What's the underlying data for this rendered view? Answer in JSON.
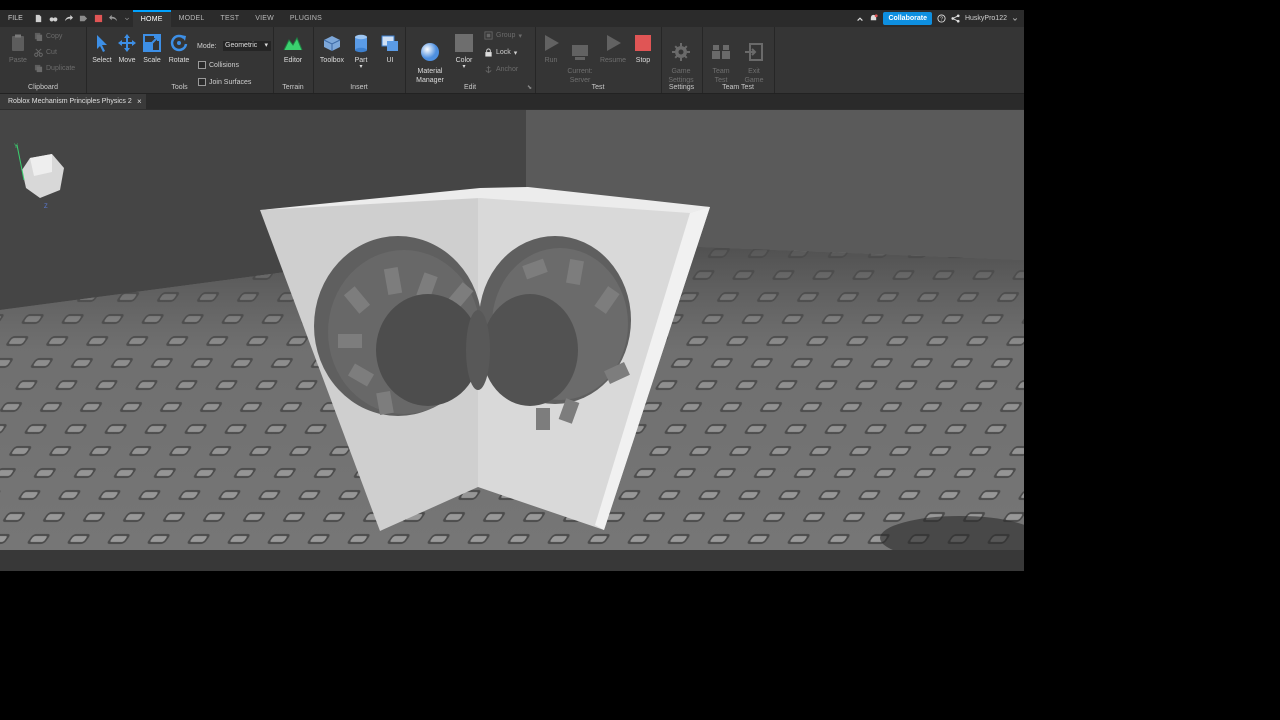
{
  "menu": {
    "file": "FILE"
  },
  "tabs": [
    {
      "label": "HOME"
    },
    {
      "label": "MODEL"
    },
    {
      "label": "TEST"
    },
    {
      "label": "VIEW"
    },
    {
      "label": "PLUGINS"
    }
  ],
  "topright": {
    "collaborate": "Collaborate",
    "username": "HuskyPro122"
  },
  "ribbon": {
    "clipboard": {
      "label": "Clipboard",
      "paste": "Paste",
      "copy": "Copy",
      "cut": "Cut",
      "duplicate": "Duplicate"
    },
    "tools": {
      "label": "Tools",
      "select": "Select",
      "move": "Move",
      "scale": "Scale",
      "rotate": "Rotate",
      "mode_label": "Mode:",
      "mode_value": "Geometric",
      "collisions": "Collisions",
      "join_surfaces": "Join Surfaces"
    },
    "terrain": {
      "label": "Terrain",
      "editor": "Editor"
    },
    "insert": {
      "label": "Insert",
      "toolbox": "Toolbox",
      "part": "Part",
      "ui": "UI"
    },
    "edit": {
      "label": "Edit",
      "material_manager": "Material\nManager",
      "color": "Color",
      "group": "Group",
      "lock": "Lock",
      "anchor": "Anchor"
    },
    "test": {
      "label": "Test",
      "run": "Run",
      "current_server": "Current:\nServer",
      "resume": "Resume",
      "stop": "Stop"
    },
    "settings": {
      "label": "Settings",
      "game_settings": "Game\nSettings"
    },
    "team_test": {
      "label": "Team Test",
      "team_test": "Team\nTest",
      "exit_game": "Exit\nGame"
    }
  },
  "document": {
    "tab_title": "Roblox Mechanism Principles Physics 2",
    "close": "×"
  },
  "colors": {
    "accent": "#00a2ff",
    "collaborate": "#0e8fe0",
    "stop": "#e05555",
    "terrain": "#3bd16f"
  }
}
